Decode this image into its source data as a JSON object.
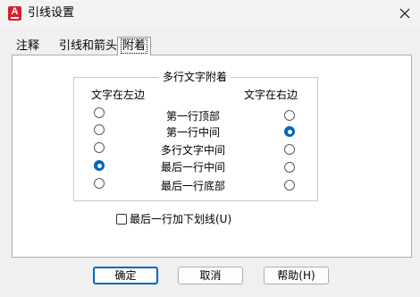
{
  "window": {
    "title": "引线设置",
    "app_icon": "autocad-icon",
    "close_icon": "close-icon"
  },
  "tabs": [
    {
      "label": "注释",
      "active": false
    },
    {
      "label": "引线和箭头",
      "active": false
    },
    {
      "label": "附着",
      "active": true
    }
  ],
  "attachment": {
    "group_title": "多行文字附着",
    "left_header": "文字在左边",
    "right_header": "文字在右边",
    "rows": [
      {
        "label": "第一行顶部",
        "left_selected": false,
        "right_selected": false
      },
      {
        "label": "第一行中间",
        "left_selected": false,
        "right_selected": true
      },
      {
        "label": "多行文字中间",
        "left_selected": false,
        "right_selected": false
      },
      {
        "label": "最后一行中间",
        "left_selected": true,
        "right_selected": false
      },
      {
        "label": "最后一行底部",
        "left_selected": false,
        "right_selected": false
      }
    ]
  },
  "underline_last_line": {
    "label": "最后一行加下划线(U)",
    "checked": false
  },
  "buttons": {
    "ok": "确定",
    "cancel": "取消",
    "help": "帮助(H)"
  },
  "colors": {
    "accent": "#0067c0",
    "app_icon_red": "#d9202a"
  }
}
